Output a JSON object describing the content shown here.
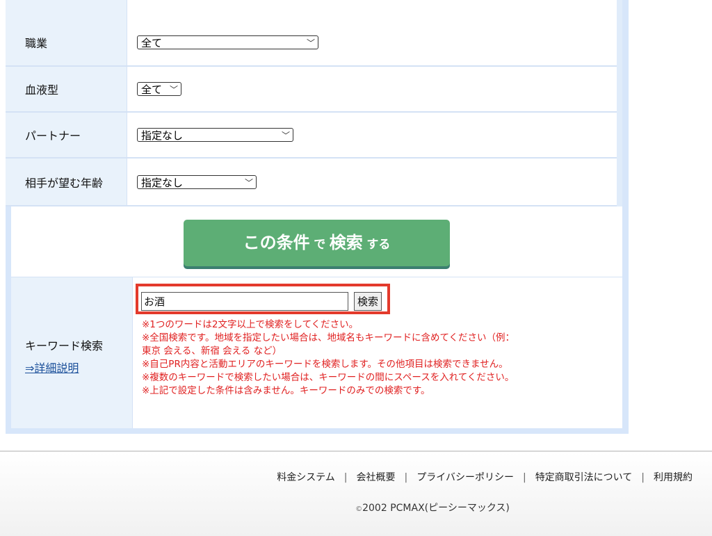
{
  "form": {
    "rows": [
      {
        "label": "",
        "value": "全て"
      },
      {
        "label": "職業",
        "value": "全て"
      },
      {
        "label": "血液型",
        "value": "全て"
      },
      {
        "label": "パートナー",
        "value": "指定なし"
      },
      {
        "label": "相手が望む年齢",
        "value": "指定なし"
      }
    ],
    "search_button": {
      "part1": "この条件",
      "part2": "で",
      "part3": "検索",
      "part4": "する"
    },
    "keyword": {
      "label": "キーワード検索",
      "detail_link": "⇒詳細説明",
      "input_value": "お酒",
      "button_label": "検索",
      "notes": [
        "※1つのワードは2文字以上で検索をしてください。",
        "※全国検索です。地域を指定したい場合は、地域名もキーワードに含めてください（例：",
        "東京 会える、新宿 会える など）",
        "※自己PR内容と活動エリアのキーワードを検索します。その他項目は検索できません。",
        "※複数のキーワードで検索したい場合は、キーワードの間にスペースを入れてください。",
        "※上記で設定した条件は含みません。キーワードのみでの検索です。"
      ]
    }
  },
  "footer": {
    "links": [
      "料金システム",
      "会社概要",
      "プライバシーポリシー",
      "特定商取引法について",
      "利用規約"
    ],
    "separator": "|",
    "copyright_mark": "©",
    "copyright_text": "2002 PCMAX(ピーシーマックス)"
  },
  "colors": {
    "accent_green": "#5dae75",
    "highlight_red": "#e33a2c",
    "note_red": "#e02121"
  },
  "icons": {
    "select_arrow": "chevron-down-icon"
  }
}
